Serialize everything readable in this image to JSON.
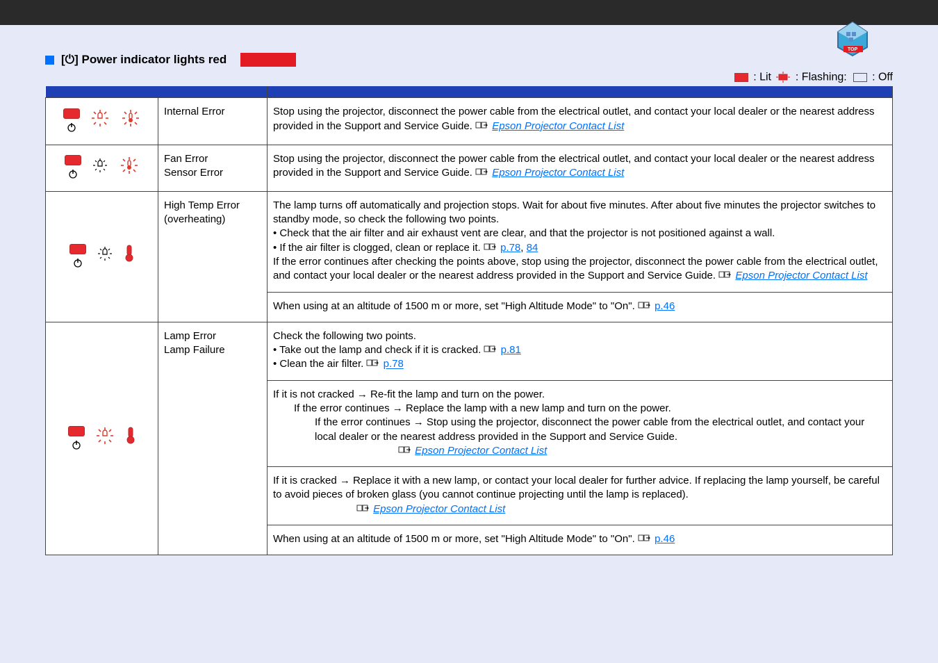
{
  "heading": "[⏻] Power indicator lights red",
  "legend": {
    "lit": ": Lit",
    "flashing": ": Flashing:",
    "off": ": Off"
  },
  "epsonLink": "Epson Projector Contact List",
  "rows": [
    {
      "cause": "Internal Error",
      "remedy": "Stop using the projector, disconnect the power cable from the electrical outlet, and contact your local dealer or the nearest address provided in the Support and Service Guide."
    },
    {
      "cause": "Fan Error\nSensor Error",
      "remedy": "Stop using the projector, disconnect the power cable from the electrical outlet, and contact your local dealer or the nearest address provided in the Support and Service Guide."
    },
    {
      "cause": "High Temp Error\n(overheating)",
      "remedyIntro": "The lamp turns off automatically and projection stops. Wait for about five minutes. After about five minutes the projector switches to standby mode, so check the following two points.",
      "bullet1a": "• Check that the air filter and air exhaust vent are clear, and that the projector is not positioned against a wall.",
      "bullet1bPrefix": "• If the air filter is clogged, clean or replace it.",
      "pageRefA": "p.78",
      "pageRefB": "84",
      "remedyTail": "If the error continues after checking the points above, stop using the projector, disconnect the power cable from the electrical outlet, and contact your local dealer or the nearest address provided in the Support and Service Guide.",
      "altitude": "When using at an altitude of 1500 m or more, set \"High Altitude Mode\" to \"On\".",
      "altitudeRef": "p.46"
    },
    {
      "cause": "Lamp Error\nLamp Failure",
      "checkHeading": "Check the following two points.",
      "bullet2a": "• Take out the lamp and check if it is cracked.",
      "bullet2aRef": "p.81",
      "bullet2b": "• Clean the air filter.",
      "bullet2bRef": "p.78",
      "notCracked": {
        "l1": "If it is not cracked → Re-fit the lamp and turn on the power.",
        "l2": "If the error continues → Replace the lamp with a new lamp and turn on the power.",
        "l3": "If the error continues → Stop using the projector, disconnect the power cable from the electrical outlet, and contact your local dealer or the nearest address provided in the Support and Service Guide."
      },
      "cracked": "If it is cracked → Replace it with a new lamp, or contact your local dealer for further advice. If replacing the lamp yourself, be careful to avoid pieces of broken glass (you cannot continue projecting until the lamp is replaced).",
      "altitude": "When using at an altitude of 1500 m or more, set \"High Altitude Mode\" to \"On\".",
      "altitudeRef": "p.46"
    }
  ]
}
